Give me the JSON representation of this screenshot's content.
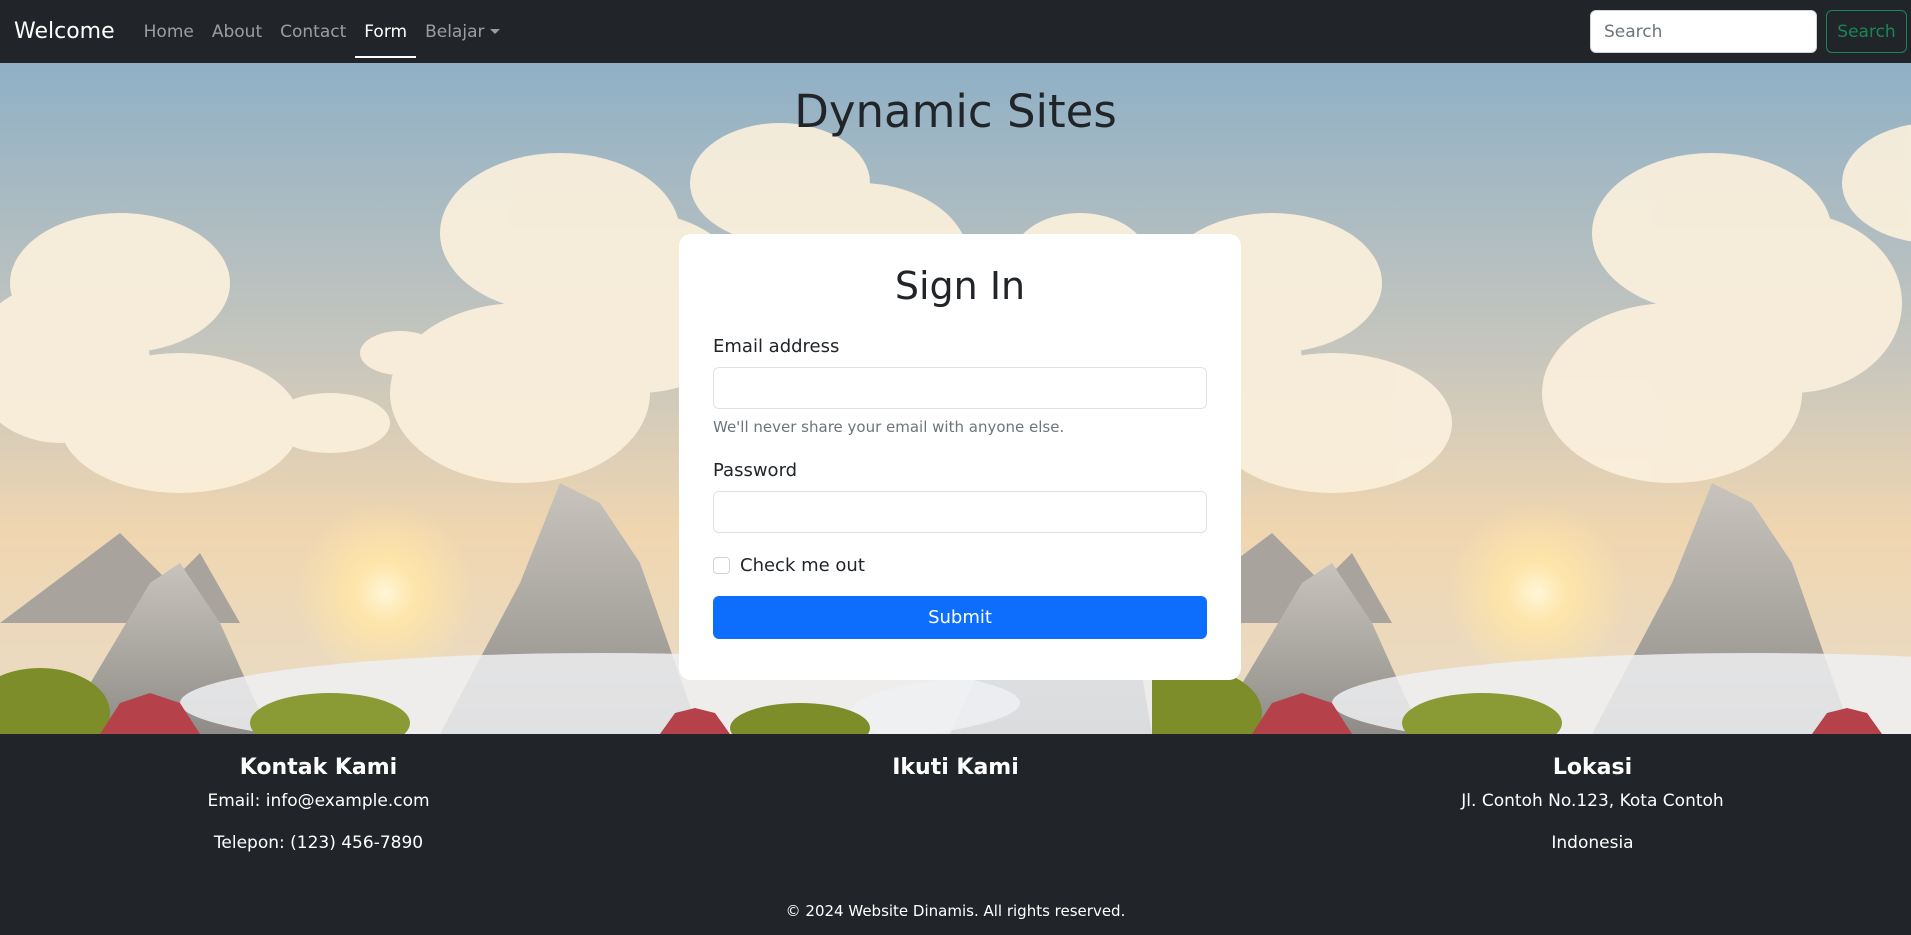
{
  "navbar": {
    "brand": "Welcome",
    "links": [
      {
        "label": "Home",
        "active": false
      },
      {
        "label": "About",
        "active": false
      },
      {
        "label": "Contact",
        "active": false
      },
      {
        "label": "Form",
        "active": true
      },
      {
        "label": "Belajar",
        "active": false,
        "dropdown": true
      }
    ],
    "search": {
      "placeholder": "Search",
      "button_label": "Search"
    }
  },
  "hero": {
    "title": "Dynamic Sites"
  },
  "signin": {
    "title": "Sign In",
    "email_label": "Email address",
    "email_value": "",
    "email_help": "We'll never share your email with anyone else.",
    "password_label": "Password",
    "password_value": "",
    "check_label": "Check me out",
    "checked": false,
    "submit_label": "Submit"
  },
  "footer": {
    "contact": {
      "title": "Kontak Kami",
      "email": "Email: info@example.com",
      "phone": "Telepon: (123) 456-7890"
    },
    "follow": {
      "title": "Ikuti Kami"
    },
    "location": {
      "title": "Lokasi",
      "address": "Jl. Contoh No.123, Kota Contoh",
      "country": "Indonesia"
    },
    "copyright": "© 2024 Website Dinamis. All rights reserved."
  },
  "colors": {
    "navbar_bg": "#212529",
    "primary": "#0d6efd",
    "success": "#198754"
  }
}
